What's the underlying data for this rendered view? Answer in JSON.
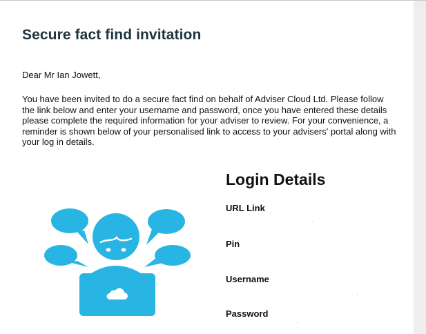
{
  "email": {
    "title": "Secure fact find invitation",
    "greeting": "Dear Mr Ian Jowett,",
    "body": "You have been invited to do a secure fact find on behalf of Adviser Cloud Ltd. Please follow the link below and enter your username and password, once you have entered these details please complete the required information for your adviser to review. For your convenience, a reminder is shown below of your personalised link to access to your advisers' portal along with your log in details."
  },
  "login": {
    "heading": "Login Details",
    "url_label": "URL Link",
    "pin_label": "Pin",
    "username_label": "Username",
    "password_label": "Password"
  },
  "colors": {
    "title": "#1e3340",
    "illustration": "#29b5e3"
  },
  "icons": {
    "illustration": "user-at-laptop-with-speech-bubbles-icon",
    "laptop_logo": "cloud-icon"
  }
}
